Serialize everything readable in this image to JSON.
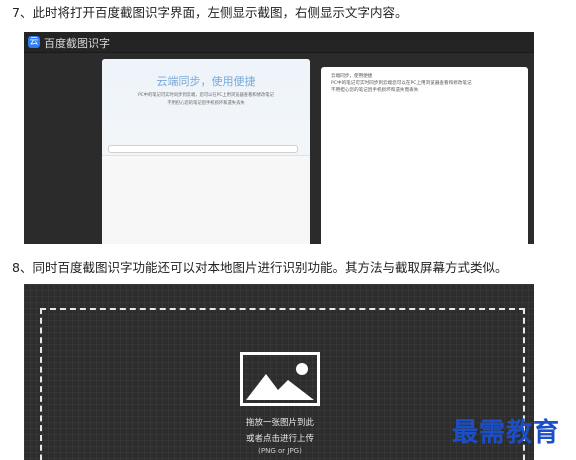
{
  "steps": {
    "step7": "7、此时将打开百度截图识字界面，左侧显示截图，右侧显示文字内容。",
    "step8": "8、同时百度截图识字功能还可以对本地图片进行识别功能。其方法与截取屏幕方式类似。"
  },
  "screenshot1": {
    "app_icon": "云",
    "app_title": "百度截图识字",
    "left_pane": {
      "heading": "云端同步，使用便捷",
      "lines": [
        "PC中的笔记可实时同步到云端，您可以在PC上用浏览器查看和修改笔记",
        "不用担心您的笔记因手机损坏和遗失丢失"
      ]
    },
    "right_pane": {
      "lines": [
        "云端同步，使用便捷",
        "PC中的笔记可实时同步到云端您可以在PC上用浏览器查看和修改笔记",
        "不用担心您的笔记因手机损坏和遗失而丢失"
      ]
    }
  },
  "screenshot2": {
    "drop_line1": "拖放一张图片到此",
    "drop_line2": "或者点击进行上传",
    "drop_hint": "(PNG or JPG)",
    "image_icon": "image-placeholder-icon"
  },
  "watermark": "最需教育"
}
